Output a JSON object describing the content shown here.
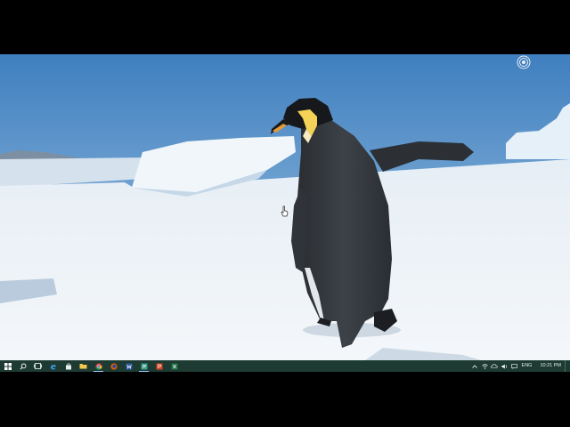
{
  "desktop": {
    "wallpaper": "emperor-penguin-on-antarctic-ice",
    "overlay_icon": "radial-rings-icon"
  },
  "taskbar": {
    "color": "#1d3b33",
    "accent": "#9ec9ff",
    "pinned": [
      {
        "name": "start-button",
        "icon": "windows-logo-icon"
      },
      {
        "name": "search-button",
        "icon": "search-icon"
      },
      {
        "name": "task-view-button",
        "icon": "task-view-icon"
      },
      {
        "name": "edge-button",
        "icon": "edge-icon"
      },
      {
        "name": "store-button",
        "icon": "store-bag-icon"
      },
      {
        "name": "file-explorer-button",
        "icon": "folder-icon"
      },
      {
        "name": "chrome-button",
        "icon": "chrome-icon",
        "running": true
      },
      {
        "name": "firefox-button",
        "icon": "firefox-icon"
      },
      {
        "name": "word-button",
        "icon": "word-icon"
      },
      {
        "name": "sway-button",
        "icon": "sway-icon",
        "running": true
      },
      {
        "name": "powerpoint-button",
        "icon": "powerpoint-icon"
      },
      {
        "name": "excel-button",
        "icon": "excel-icon"
      }
    ],
    "tray": {
      "language": "ENG",
      "time": "10:21 PM"
    }
  }
}
